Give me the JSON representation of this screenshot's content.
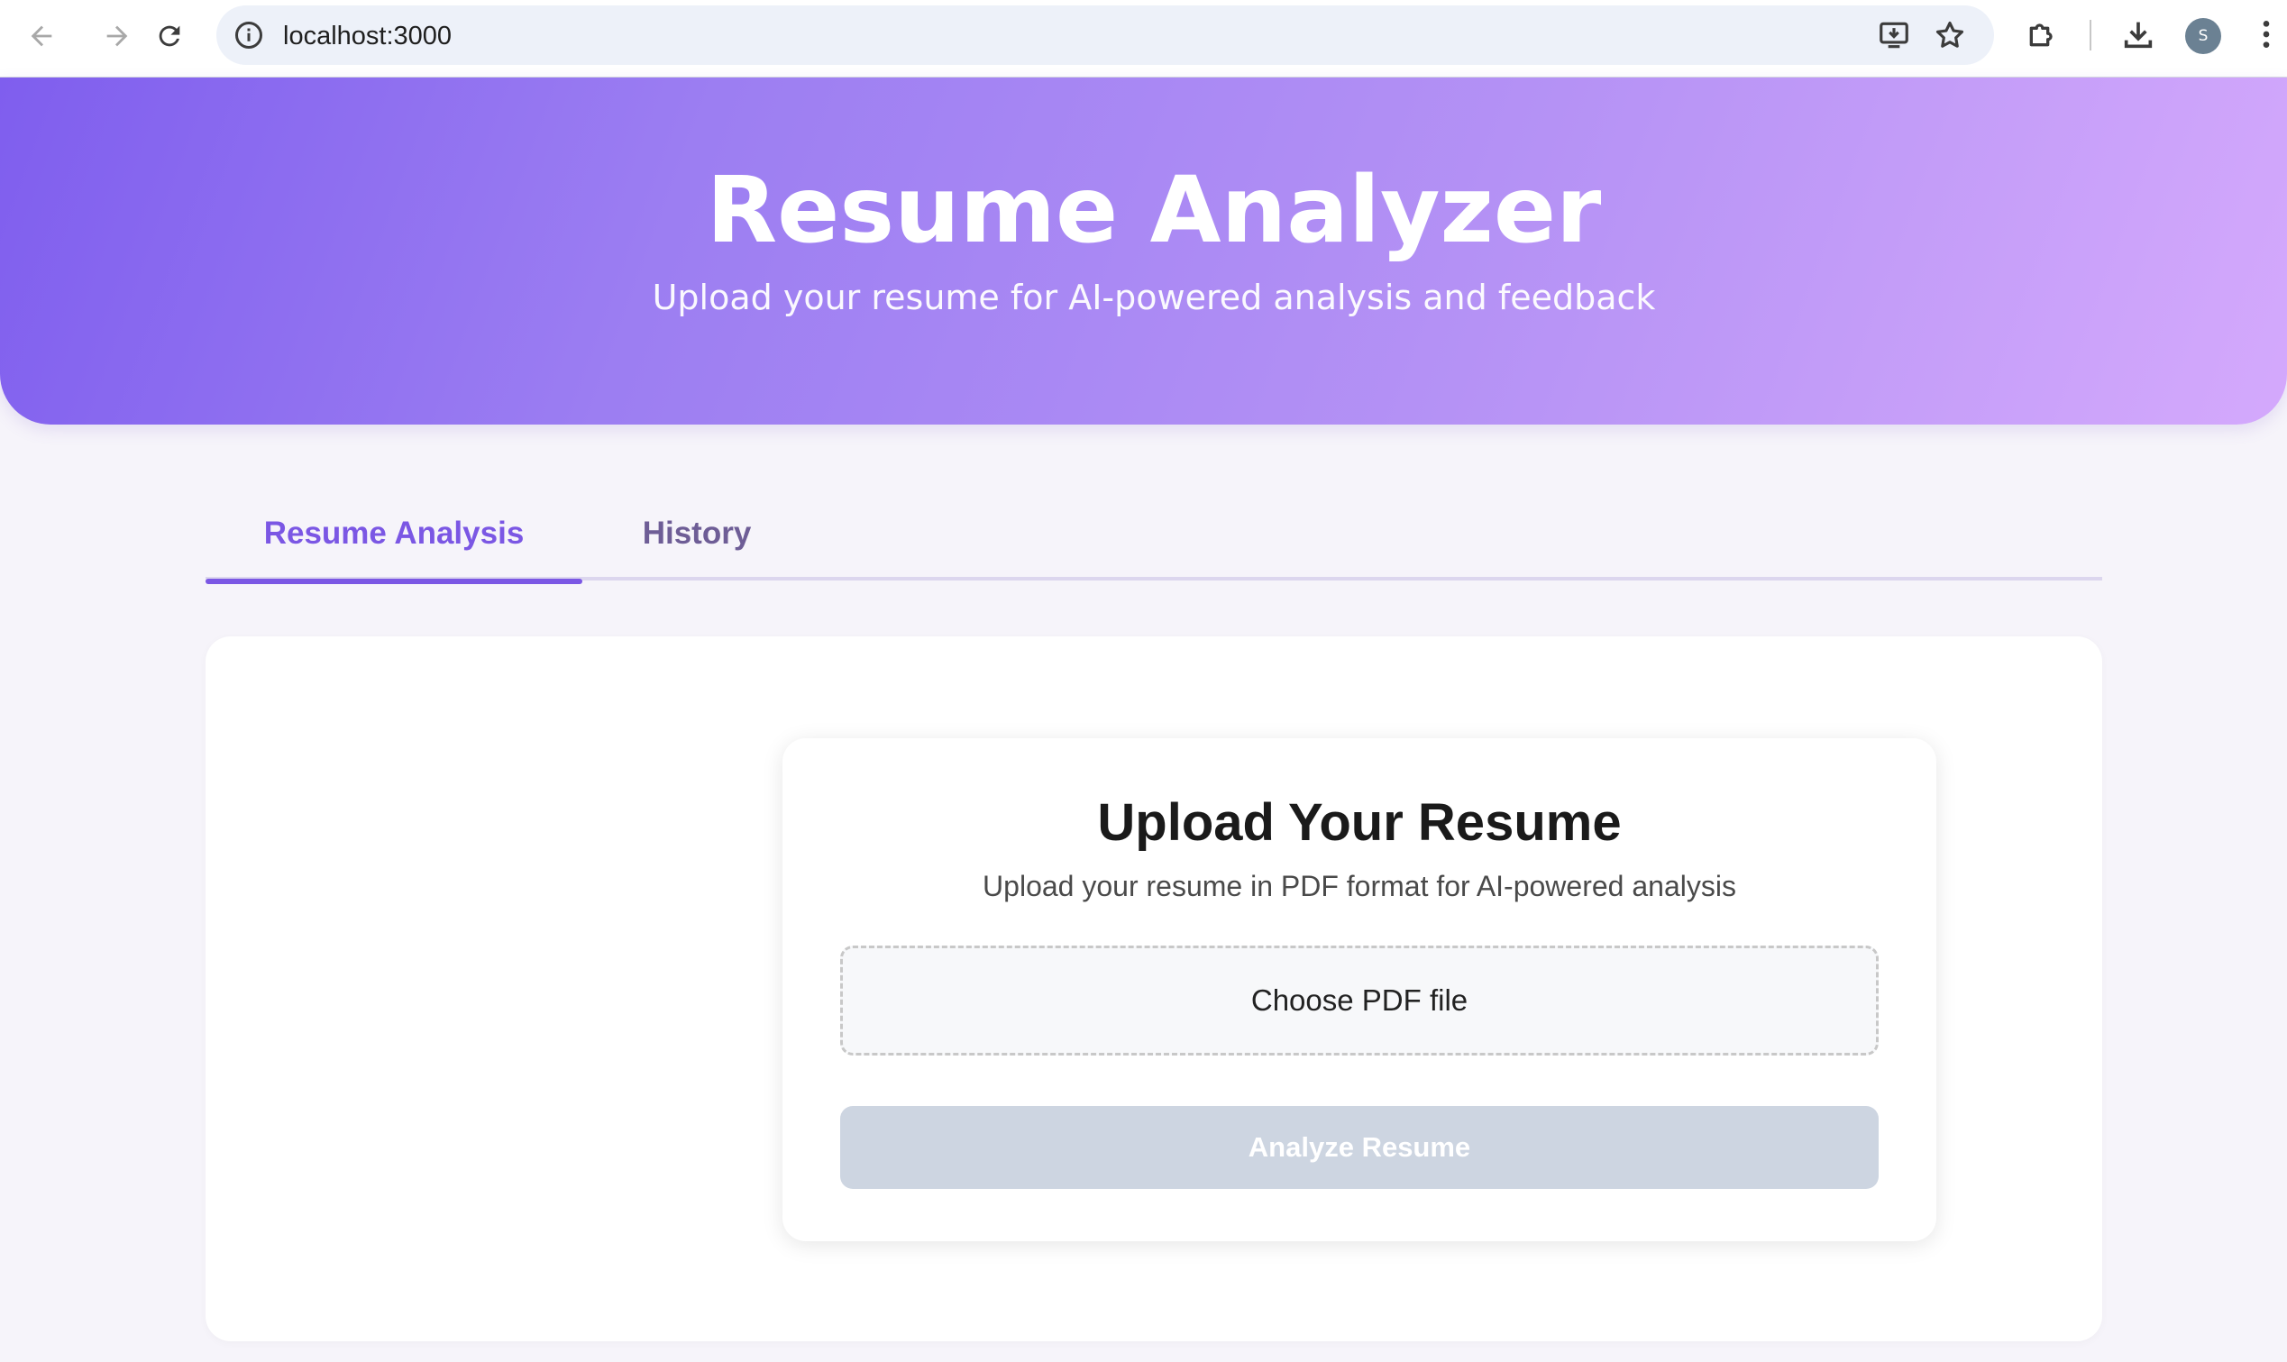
{
  "browser": {
    "url": "localhost:3000",
    "profile_initial": "S"
  },
  "hero": {
    "title": "Resume Analyzer",
    "subtitle": "Upload your resume for AI-powered analysis and feedback"
  },
  "tabs": [
    {
      "label": "Resume Analysis",
      "active": true
    },
    {
      "label": "History",
      "active": false
    }
  ],
  "upload": {
    "title": "Upload Your Resume",
    "description": "Upload your resume in PDF format for AI-powered analysis",
    "file_button_label": "Choose PDF file",
    "analyze_button_label": "Analyze Resume",
    "analyze_disabled": true
  },
  "colors": {
    "accent": "#7b57e4",
    "hero_gradient_start": "#7f5eee",
    "hero_gradient_end": "#d4a9fc",
    "disabled_button": "#cdd5e1"
  }
}
